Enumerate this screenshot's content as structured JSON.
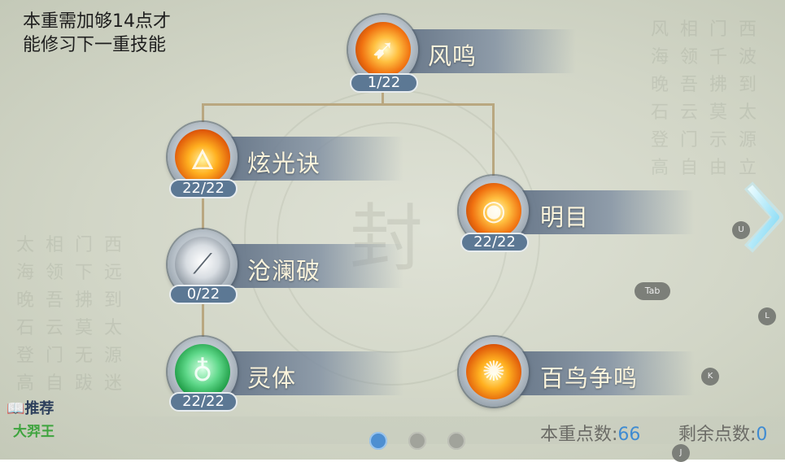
{
  "requirement_text_line1": "本重需加够14点才",
  "requirement_text_line2": "能修习下一重技能",
  "skills": [
    {
      "name": "风鸣",
      "level": "1/22",
      "icon": "feather-arrow-icon"
    },
    {
      "name": "炫光诀",
      "level": "22/22",
      "icon": "phoenix-icon"
    },
    {
      "name": "明目",
      "level": "22/22",
      "icon": "flaming-eye-icon"
    },
    {
      "name": "沧澜破",
      "level": "0/22",
      "icon": "ice-blades-icon"
    },
    {
      "name": "灵体",
      "level": "22/22",
      "icon": "spirit-body-icon"
    },
    {
      "name": "百鸟争鸣",
      "level": "22/22",
      "icon": "hundred-birds-icon"
    }
  ],
  "points": {
    "current_label": "本重点数:",
    "current_value": "66",
    "remaining_label": "剩余点数:",
    "remaining_value": "0"
  },
  "recommend": {
    "label": "推荐",
    "name": "大羿王"
  },
  "hotkeys": {
    "u": "U",
    "tab": "Tab",
    "l": "L",
    "k": "K",
    "j": "J"
  },
  "pagination": {
    "current_page": 1,
    "total_pages": 3
  },
  "colors": {
    "accent_blue": "#3f8bd2",
    "level_badge": "#5c7894",
    "recommend_green": "#3ea43e"
  }
}
